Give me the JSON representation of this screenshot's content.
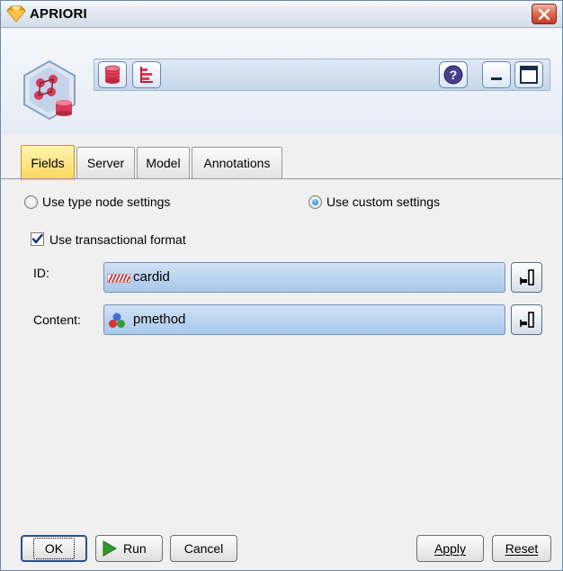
{
  "window": {
    "title": "APRIORI"
  },
  "toolbar": {
    "buttons": [
      {
        "name": "preview-database-icon"
      },
      {
        "name": "chart-icon"
      }
    ],
    "help_icon": "help-icon",
    "minimize_icon": "minimize-icon",
    "maximize_icon": "maximize-icon"
  },
  "tabs": [
    {
      "label": "Fields",
      "active": true
    },
    {
      "label": "Server",
      "active": false
    },
    {
      "label": "Model",
      "active": false
    },
    {
      "label": "Annotations",
      "active": false
    }
  ],
  "settings": {
    "use_type_node": {
      "label": "Use type node settings",
      "selected": false
    },
    "use_custom": {
      "label": "Use custom settings",
      "selected": true
    },
    "transactional": {
      "label": "Use transactional format",
      "checked": true
    }
  },
  "fields": {
    "id": {
      "label": "ID:",
      "value": "cardid",
      "icon": "id-field-icon"
    },
    "content": {
      "label": "Content:",
      "value": "pmethod",
      "icon": "set-field-icon"
    }
  },
  "buttons": {
    "ok": "OK",
    "run": "Run",
    "cancel": "Cancel",
    "apply": "Apply",
    "reset": "Reset"
  },
  "colors": {
    "titlebar": "#dfe6ef",
    "active_tab": "#fbd75a",
    "field_box": "#a9c8ea",
    "close_button": "#e0664d",
    "run_icon": "#2e9a2e"
  }
}
